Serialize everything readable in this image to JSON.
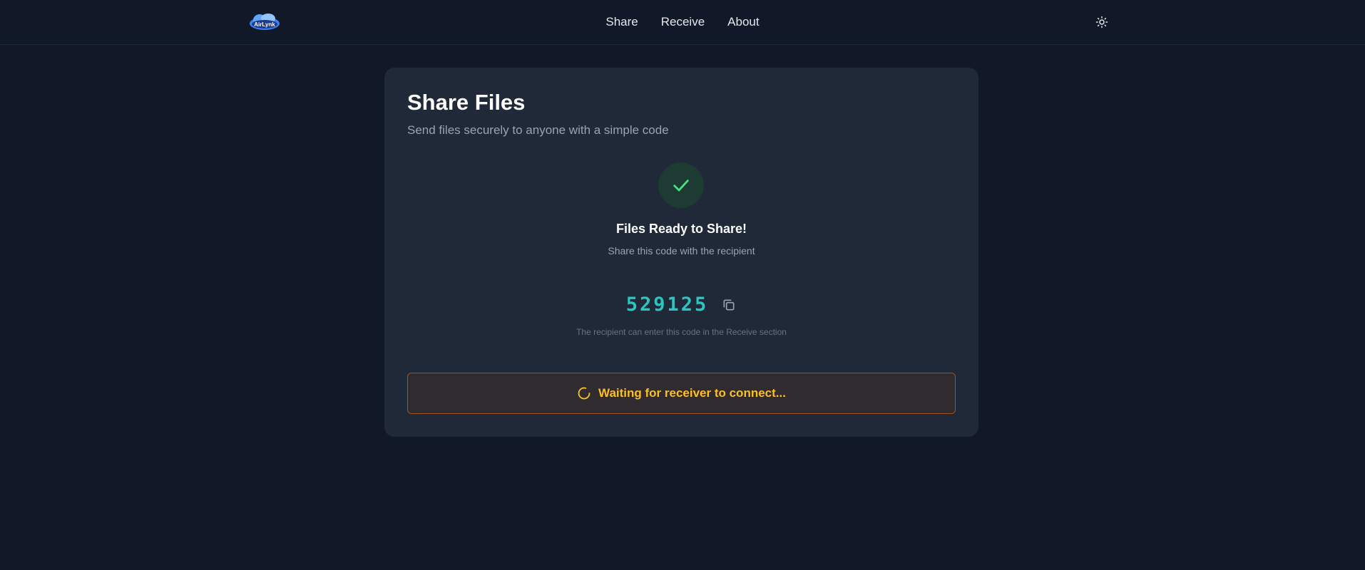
{
  "header": {
    "logo_text": "AirLynk",
    "nav": {
      "share": "Share",
      "receive": "Receive",
      "about": "About"
    },
    "theme_toggle_icon": "sun-icon"
  },
  "card": {
    "title": "Share Files",
    "subtitle": "Send files securely to anyone with a simple code",
    "status_icon": "check-icon",
    "ready_title": "Files Ready to Share!",
    "ready_subtitle": "Share this code with the recipient",
    "code": "529125",
    "copy_icon": "copy-icon",
    "code_hint": "The recipient can enter this code in the Receive section",
    "waiting_icon": "spinner-icon",
    "waiting_text": "Waiting for receiver to connect..."
  },
  "colors": {
    "background": "#111827",
    "card": "#1f2937",
    "accent_teal": "#2dc5c0",
    "success_green": "#4ade80",
    "warning_amber": "#fbbf24",
    "warning_border": "#a1531a"
  }
}
